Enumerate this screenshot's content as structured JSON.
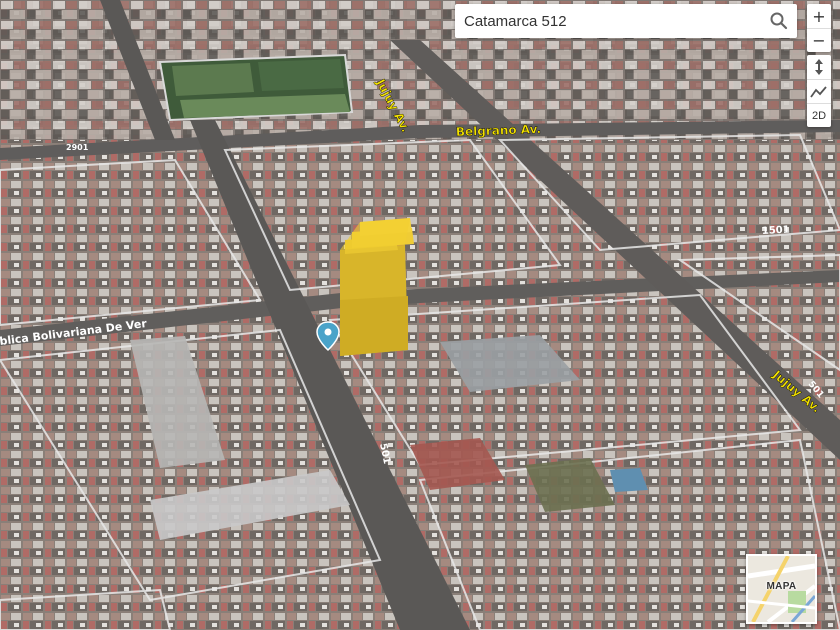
{
  "search": {
    "value": "Catamarca 512",
    "icon": "search-icon"
  },
  "controls": {
    "zoom_in": "+",
    "zoom_out": "−",
    "tilt_icon": "tilt-arrows-icon",
    "terrain_icon": "terrain-line-icon",
    "mode_2d": "2D"
  },
  "streets": {
    "jujuy_top": "Jujuy Av.",
    "belgrano": "Belgrano Av.",
    "bolivariana": "blica Bolivariana De Ver",
    "jujuy_right": "Jujuy Av.",
    "number_top_left": "2901",
    "number_right_1501": "1501",
    "number_center_501": "501",
    "number_right_501": "501"
  },
  "minimap": {
    "label": "MAPA"
  },
  "marker": {
    "icon": "location-pin-icon",
    "color": "#4aa3c9"
  },
  "building_highlight_color": "#f2cf2f"
}
